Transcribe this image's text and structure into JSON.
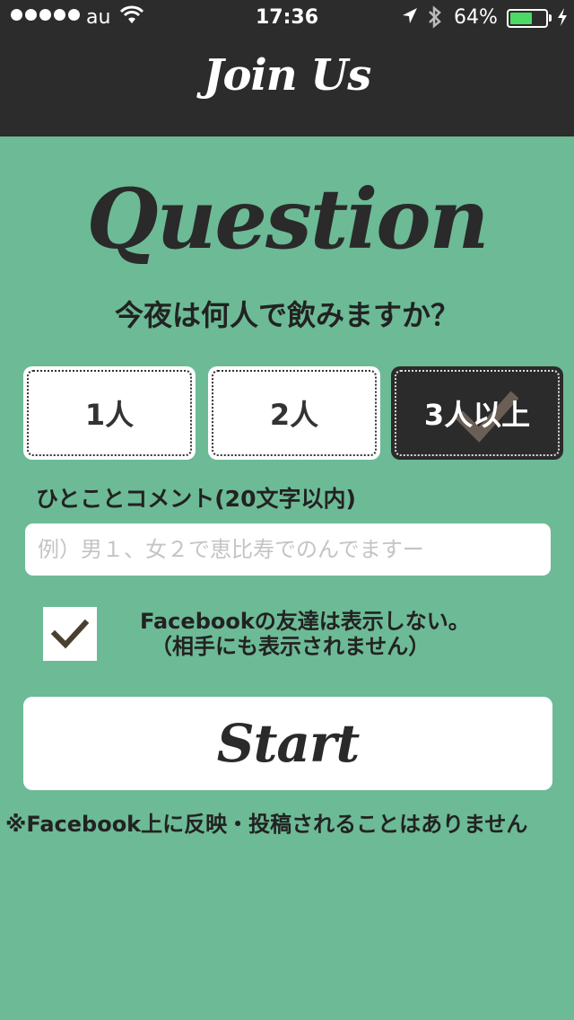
{
  "status_bar": {
    "carrier": "au",
    "time": "17:36",
    "battery_percent": "64%",
    "battery_level": 0.64,
    "battery_color": "#4cd964"
  },
  "nav": {
    "title": "Join Us"
  },
  "question": {
    "heading": "Question",
    "text": "今夜は何人で飲みますか？",
    "options": [
      {
        "label": "1人",
        "selected": false
      },
      {
        "label": "2人",
        "selected": false
      },
      {
        "label": "3人以上",
        "selected": true
      }
    ]
  },
  "comment": {
    "label": "ひとことコメント(20文字以内)",
    "placeholder": "例）男１、女２で恵比寿でのんでますー",
    "value": ""
  },
  "facebook_option": {
    "checked": true,
    "line1": "Facebookの友達は表示しない。",
    "line2": "（相手にも表示されません）"
  },
  "start_label": "Start",
  "notice": "※Facebook上に反映・投稿されることはありません",
  "colors": {
    "background": "#6dba96",
    "header": "#2b2c2b",
    "selected_option": "#2b2b2b",
    "check": "#4a4030"
  }
}
